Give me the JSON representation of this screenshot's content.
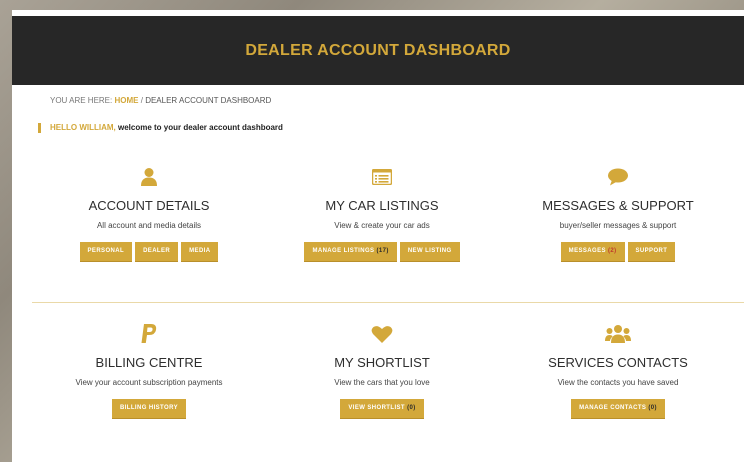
{
  "header": {
    "title": "DEALER ACCOUNT DASHBOARD"
  },
  "breadcrumb": {
    "prefix": "YOU ARE HERE:",
    "home": "HOME",
    "separator": "/",
    "current": "DEALER ACCOUNT DASHBOARD"
  },
  "greeting": {
    "name": "HELLO WILLIAM,",
    "message": "welcome to your dealer account dashboard"
  },
  "colors": {
    "accent": "#d3a83a",
    "header_bg": "#272727"
  },
  "cards": [
    {
      "icon": "user-icon",
      "title": "ACCOUNT DETAILS",
      "desc": "All account and media details",
      "buttons": [
        {
          "label": "PERSONAL"
        },
        {
          "label": "DEALER"
        },
        {
          "label": "MEDIA"
        }
      ]
    },
    {
      "icon": "list-icon",
      "title": "MY CAR LISTINGS",
      "desc": "View & create your car ads",
      "buttons": [
        {
          "label": "MANAGE LISTINGS",
          "count": "(17)"
        },
        {
          "label": "NEW LISTING"
        }
      ]
    },
    {
      "icon": "chat-bubble-icon",
      "title": "MESSAGES & SUPPORT",
      "desc": "buyer/seller messages & support",
      "buttons": [
        {
          "label": "MESSAGES",
          "count": "(2)"
        },
        {
          "label": "SUPPORT"
        }
      ]
    },
    {
      "icon": "paypal-icon",
      "title": "BILLING CENTRE",
      "desc": "View your account subscription payments",
      "buttons": [
        {
          "label": "BILLING HISTORY"
        }
      ]
    },
    {
      "icon": "heart-icon",
      "title": "MY SHORTLIST",
      "desc": "View the cars that you love",
      "buttons": [
        {
          "label": "VIEW SHORTLIST",
          "count": "(0)"
        }
      ]
    },
    {
      "icon": "users-icon",
      "title": "SERVICES CONTACTS",
      "desc": "View the contacts you have saved",
      "buttons": [
        {
          "label": "MANAGE CONTACTS",
          "count": "(0)"
        }
      ]
    }
  ]
}
